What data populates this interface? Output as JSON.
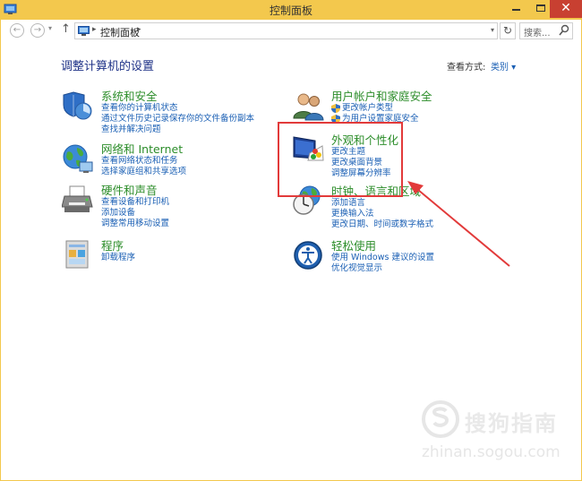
{
  "window": {
    "title": "控制面板"
  },
  "address": {
    "back_glyph": "←",
    "forward_glyph": "→",
    "up_glyph": "↑",
    "breadcrumb_separator": "▸",
    "path": "控制面板",
    "refresh_glyph": "↻"
  },
  "search": {
    "placeholder": "搜索...",
    "value": ""
  },
  "main": {
    "title": "调整计算机的设置",
    "view_by_label": "查看方式:",
    "view_by_value": "类别 ▾"
  },
  "categories": [
    {
      "title": "系统和安全",
      "icon": "shield-computer-icon",
      "links": [
        "查看你的计算机状态",
        "通过文件历史记录保存你的文件备份副本",
        "查找并解决问题"
      ]
    },
    {
      "title": "网络和 Internet",
      "icon": "network-globe-icon",
      "links": [
        "查看网络状态和任务",
        "选择家庭组和共享选项"
      ]
    },
    {
      "title": "硬件和声音",
      "icon": "printer-icon",
      "links": [
        "查看设备和打印机",
        "添加设备",
        "调整常用移动设置"
      ]
    },
    {
      "title": "程序",
      "icon": "programs-icon",
      "links": [
        "卸载程序"
      ]
    },
    {
      "title": "用户帐户和家庭安全",
      "icon": "users-icon",
      "links": [
        "更改帐户类型",
        "为用户设置家庭安全"
      ]
    },
    {
      "title": "外观和个性化",
      "icon": "monitor-paint-icon",
      "links": [
        "更改主题",
        "更改桌面背景",
        "调整屏幕分辨率"
      ]
    },
    {
      "title": "时钟、语言和区域",
      "icon": "clock-globe-icon",
      "links": [
        "添加语言",
        "更换输入法",
        "更改日期、时间或数字格式"
      ]
    },
    {
      "title": "轻松使用",
      "icon": "ease-of-access-icon",
      "links": [
        "使用 Windows 建议的设置",
        "优化视觉显示"
      ]
    }
  ],
  "watermark": {
    "brand": "搜狗指南",
    "url": "zhinan.sogou.com"
  },
  "colors": {
    "title_bar": "#f3c84d",
    "close_button": "#c84031",
    "category_title": "#2c8d2a",
    "link": "#1a5fb4",
    "page_title": "#1e3287",
    "highlight": "#e23a3a"
  }
}
